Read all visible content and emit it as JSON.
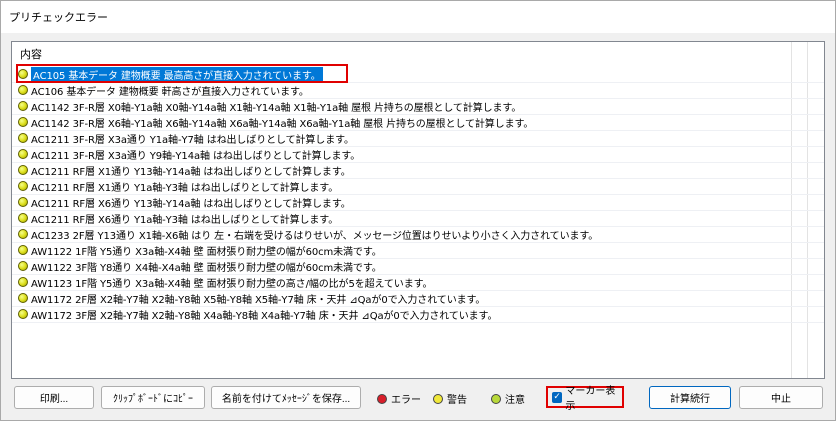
{
  "window": {
    "title": "プリチェックエラー"
  },
  "list": {
    "header": "内容",
    "rows": [
      {
        "text": "AC105 基本データ 建物概要 最高高さが直接入力されています。",
        "status": "warning",
        "selected": true
      },
      {
        "text": "AC106 基本データ 建物概要 軒高さが直接入力されています。",
        "status": "warning"
      },
      {
        "text": "AC1142 3F-R層 X0軸-Y1a軸 X0軸-Y14a軸 X1軸-Y14a軸 X1軸-Y1a軸  屋根 片持ちの屋根として計算します。",
        "status": "warning"
      },
      {
        "text": "AC1142 3F-R層 X6軸-Y1a軸 X6軸-Y14a軸 X6a軸-Y14a軸 X6a軸-Y1a軸  屋根 片持ちの屋根として計算します。",
        "status": "warning"
      },
      {
        "text": "AC1211 3F-R層 X3a通り Y1a軸-Y7軸 はね出しばりとして計算します。",
        "status": "warning"
      },
      {
        "text": "AC1211 3F-R層 X3a通り Y9軸-Y14a軸 はね出しばりとして計算します。",
        "status": "warning"
      },
      {
        "text": "AC1211 RF層 X1通り Y13軸-Y14a軸 はね出しばりとして計算します。",
        "status": "warning"
      },
      {
        "text": "AC1211 RF層 X1通り Y1a軸-Y3軸 はね出しばりとして計算します。",
        "status": "warning"
      },
      {
        "text": "AC1211 RF層 X6通り Y13軸-Y14a軸 はね出しばりとして計算します。",
        "status": "warning"
      },
      {
        "text": "AC1211 RF層 X6通り Y1a軸-Y3軸 はね出しばりとして計算します。",
        "status": "warning"
      },
      {
        "text": "AC1233 2F層 Y13通り X1軸-X6軸 はり 左・右端を受けるはりせいが、メッセージ位置はりせいより小さく入力されています。",
        "status": "warning"
      },
      {
        "text": "AW1122 1F階 Y5通り X3a軸-X4軸 壁 面材張り耐力壁の幅が60cm未満です。",
        "status": "warning"
      },
      {
        "text": "AW1122 3F階 Y8通り X4軸-X4a軸 壁 面材張り耐力壁の幅が60cm未満です。",
        "status": "warning"
      },
      {
        "text": "AW1123 1F階 Y5通り X3a軸-X4軸 壁 面材張り耐力壁の高さ/幅の比が5を超えています。",
        "status": "warning"
      },
      {
        "text": "AW1172 2F層 X2軸-Y7軸 X2軸-Y8軸 X5軸-Y8軸 X5軸-Y7軸  床・天井 ⊿Qaが0で入力されています。",
        "status": "warning"
      },
      {
        "text": "AW1172 3F層 X2軸-Y7軸 X2軸-Y8軸 X4a軸-Y8軸 X4a軸-Y7軸  床・天井 ⊿Qaが0で入力されています。",
        "status": "warning"
      }
    ]
  },
  "buttons": {
    "print": "印刷...",
    "copy_clipboard": "ｸﾘｯﾌﾟﾎﾞｰﾄﾞにｺﾋﾟｰ",
    "save_message": "名前を付けてﾒｯｾｰｼﾞを保存...",
    "continue_calc": "計算続行",
    "stop": "中止"
  },
  "legend": {
    "error": "エラー",
    "warning": "警告",
    "caution": "注意"
  },
  "marker_toggle": {
    "label": "マーカー表示",
    "checked": true
  },
  "colors": {
    "error": "#d81e2a",
    "warning": "#f0e83a",
    "caution": "#b8d93a",
    "selection": "#0078d7",
    "highlight_frame": "#e00000"
  }
}
